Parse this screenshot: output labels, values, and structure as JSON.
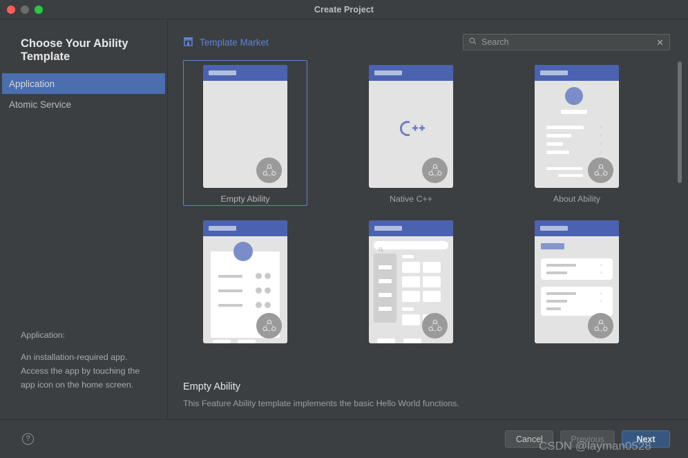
{
  "window": {
    "title": "Create Project",
    "traffic_lights": [
      "close-button",
      "minimize-button",
      "zoom-button"
    ]
  },
  "left_pane": {
    "title": "Choose Your Ability Template",
    "items": [
      {
        "label": "Application",
        "selected": true
      },
      {
        "label": "Atomic Service",
        "selected": false
      }
    ],
    "description_lead": "Application:",
    "description_body": "An installation-required app. Access the app by touching the app icon on the home screen."
  },
  "toolbar": {
    "market_label": "Template Market",
    "market_icon": "storefront-icon",
    "search": {
      "icon": "search-icon",
      "placeholder": "Search",
      "value": "",
      "clear_icon": "close-icon",
      "clear_label": "✕"
    }
  },
  "templates": [
    {
      "label": "Empty Ability",
      "selected": true,
      "thumb": "blank-page"
    },
    {
      "label": "Native C++",
      "selected": false,
      "thumb": "cpp-logo",
      "logo_text": "C++"
    },
    {
      "label": "About Ability",
      "selected": false,
      "thumb": "about-list"
    },
    {
      "label": "",
      "selected": false,
      "thumb": "profile-card"
    },
    {
      "label": "",
      "selected": false,
      "thumb": "category-grid"
    },
    {
      "label": "",
      "selected": false,
      "thumb": "settings-list"
    }
  ],
  "detail": {
    "title": "Empty Ability",
    "description": "This Feature Ability template implements the basic Hello World functions."
  },
  "footer": {
    "help_icon": "help-icon",
    "help_glyph": "?",
    "buttons": [
      {
        "label": "Cancel",
        "style": "normal",
        "disabled": false
      },
      {
        "label": "Previous",
        "style": "normal",
        "disabled": true
      },
      {
        "label": "Next",
        "style": "primary",
        "disabled": false
      }
    ]
  },
  "watermark": "CSDN @layman0528",
  "colors": {
    "window_bg": "#3c3f41",
    "accent_blue": "#4b6eaf",
    "link_blue": "#5c84d8",
    "selection_border": "#5c84d8",
    "thumb_header": "#4a62b0",
    "thumb_bg": "#e3e3e3",
    "primary_button": "#365880"
  },
  "scrollbar": {
    "orientation": "vertical",
    "thumb_position": "top"
  }
}
